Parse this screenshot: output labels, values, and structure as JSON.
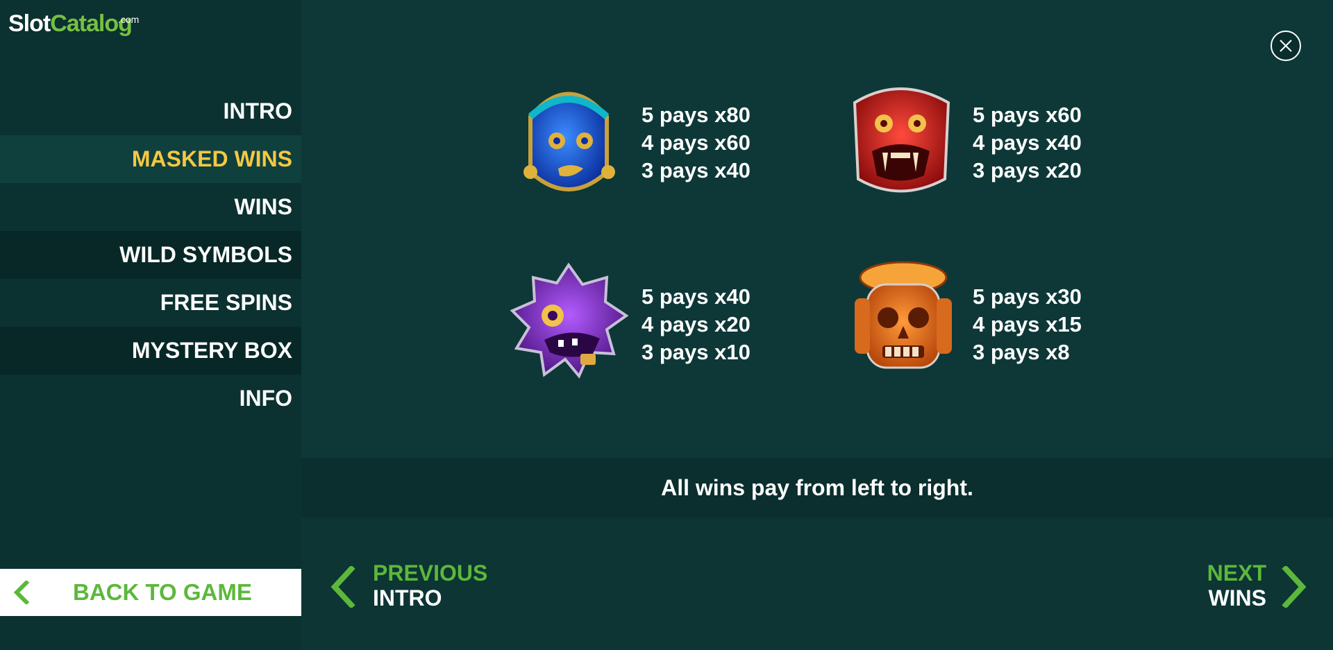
{
  "logo": {
    "slot": "Slot",
    "catalog": "Catalog",
    "com": ".com"
  },
  "sidebar": {
    "items": [
      {
        "label": "INTRO"
      },
      {
        "label": "MASKED WINS"
      },
      {
        "label": "WINS"
      },
      {
        "label": "WILD SYMBOLS"
      },
      {
        "label": "FREE SPINS"
      },
      {
        "label": "MYSTERY BOX"
      },
      {
        "label": "INFO"
      }
    ],
    "back_label": "BACK TO GAME"
  },
  "symbols": [
    {
      "icon": "blue-mask-icon",
      "pays": [
        "5 pays x80",
        "4 pays x60",
        "3 pays x40"
      ]
    },
    {
      "icon": "red-mask-icon",
      "pays": [
        "5 pays x60",
        "4 pays x40",
        "3 pays x20"
      ]
    },
    {
      "icon": "purple-mask-icon",
      "pays": [
        "5 pays x40",
        "4 pays x20",
        "3 pays x10"
      ]
    },
    {
      "icon": "orange-mask-icon",
      "pays": [
        "5 pays x30",
        "4 pays x15",
        "3 pays x8"
      ]
    }
  ],
  "note": "All wins pay from left to right.",
  "nav": {
    "prev_label": "PREVIOUS",
    "prev_target": "INTRO",
    "next_label": "NEXT",
    "next_target": "WINS"
  },
  "colors": {
    "accent_green": "#5cb83b",
    "active_yellow": "#f5c842",
    "background": "#0c3534"
  }
}
